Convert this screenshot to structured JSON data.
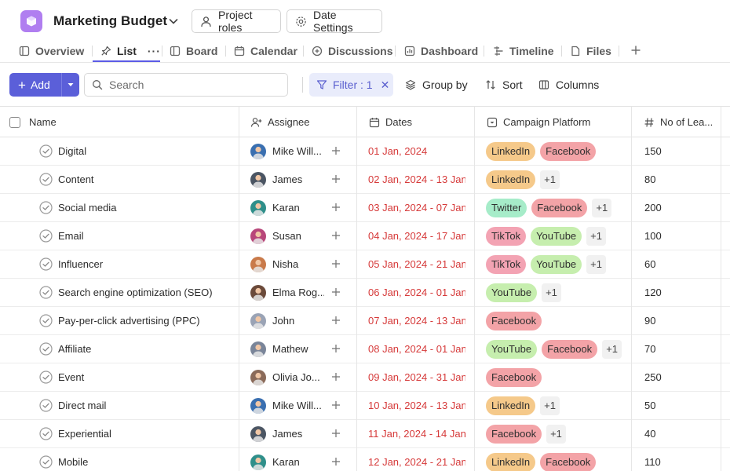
{
  "header": {
    "title": "Marketing Budget",
    "project_roles_label": "Project roles",
    "date_settings_label": "Date Settings",
    "app_icon_color": "#b07ef0"
  },
  "tabs": [
    {
      "label": "Overview",
      "icon": "overview-icon",
      "active": false
    },
    {
      "label": "List",
      "icon": "pin-icon",
      "active": true
    },
    {
      "label": "Board",
      "icon": "board-icon",
      "active": false
    },
    {
      "label": "Calendar",
      "icon": "calendar-icon",
      "active": false
    },
    {
      "label": "Discussions",
      "icon": "discussions-icon",
      "active": false
    },
    {
      "label": "Dashboard",
      "icon": "dashboard-icon",
      "active": false
    },
    {
      "label": "Timeline",
      "icon": "timeline-icon",
      "active": false
    },
    {
      "label": "Files",
      "icon": "files-icon",
      "active": false
    }
  ],
  "toolbar": {
    "add_label": "Add",
    "search_placeholder": "Search",
    "filter_label": "Filter : 1",
    "group_by_label": "Group by",
    "sort_label": "Sort",
    "columns_label": "Columns",
    "accent_color": "#5b5fd9"
  },
  "columns": {
    "name": "Name",
    "assignee": "Assignee",
    "dates": "Dates",
    "platform": "Campaign Platform",
    "leads": "No of Lea..."
  },
  "tag_colors": {
    "LinkedIn": "#f5c98a",
    "Facebook": "#f3a3a7",
    "Twitter": "#a6ecc9",
    "TikTok": "#f3a3b3",
    "YouTube": "#c6eeae"
  },
  "rows": [
    {
      "name": "Digital",
      "assignee": "Mike Will...",
      "avatar_color": "#3a6fb0",
      "dates": "01 Jan, 2024",
      "tags": [
        "LinkedIn",
        "Facebook"
      ],
      "more": "",
      "leads": "150"
    },
    {
      "name": "Content",
      "assignee": "James",
      "avatar_color": "#4b5563",
      "dates": "02 Jan, 2024 - 13 Jan...",
      "tags": [
        "LinkedIn"
      ],
      "more": "+1",
      "leads": "80"
    },
    {
      "name": "Social media",
      "assignee": "Karan",
      "avatar_color": "#2f8f8a",
      "dates": "03 Jan, 2024 - 07 Jan...",
      "tags": [
        "Twitter",
        "Facebook"
      ],
      "more": "+1",
      "leads": "200"
    },
    {
      "name": "Email",
      "assignee": "Susan",
      "avatar_color": "#b8477a",
      "dates": "04 Jan, 2024 - 17 Jan...",
      "tags": [
        "TikTok",
        "YouTube"
      ],
      "more": "+1",
      "leads": "100"
    },
    {
      "name": "Influencer",
      "assignee": "Nisha",
      "avatar_color": "#c97a4a",
      "dates": "05 Jan, 2024 - 21 Jan...",
      "tags": [
        "TikTok",
        "YouTube"
      ],
      "more": "+1",
      "leads": "60"
    },
    {
      "name": "Search engine optimization (SEO)",
      "assignee": "Elma Rog...",
      "avatar_color": "#6b4a3a",
      "dates": "06 Jan, 2024 - 01 Jan...",
      "tags": [
        "YouTube"
      ],
      "more": "+1",
      "leads": "120"
    },
    {
      "name": "Pay-per-click advertising (PPC)",
      "assignee": "John",
      "avatar_color": "#9aa3b5",
      "dates": "07 Jan, 2024 - 13 Jan...",
      "tags": [
        "Facebook"
      ],
      "more": "",
      "leads": "90"
    },
    {
      "name": "Affiliate",
      "assignee": "Mathew",
      "avatar_color": "#7a8599",
      "dates": "08 Jan, 2024 - 01 Jan...",
      "tags": [
        "YouTube",
        "Facebook"
      ],
      "more": "+1",
      "leads": "70"
    },
    {
      "name": "Event",
      "assignee": "Olivia Jo...",
      "avatar_color": "#8b6b5a",
      "dates": "09 Jan, 2024 - 31 Jan...",
      "tags": [
        "Facebook"
      ],
      "more": "",
      "leads": "250"
    },
    {
      "name": "Direct mail",
      "assignee": "Mike Will...",
      "avatar_color": "#3a6fb0",
      "dates": "10 Jan, 2024 - 13 Jan...",
      "tags": [
        "LinkedIn"
      ],
      "more": "+1",
      "leads": "50"
    },
    {
      "name": "Experiential",
      "assignee": "James",
      "avatar_color": "#4b5563",
      "dates": "11 Jan, 2024 - 14 Jan...",
      "tags": [
        "Facebook"
      ],
      "more": "+1",
      "leads": "40"
    },
    {
      "name": "Mobile",
      "assignee": "Karan",
      "avatar_color": "#2f8f8a",
      "dates": "12 Jan, 2024 - 21 Jan...",
      "tags": [
        "LinkedIn",
        "Facebook"
      ],
      "more": "",
      "leads": "110"
    }
  ]
}
